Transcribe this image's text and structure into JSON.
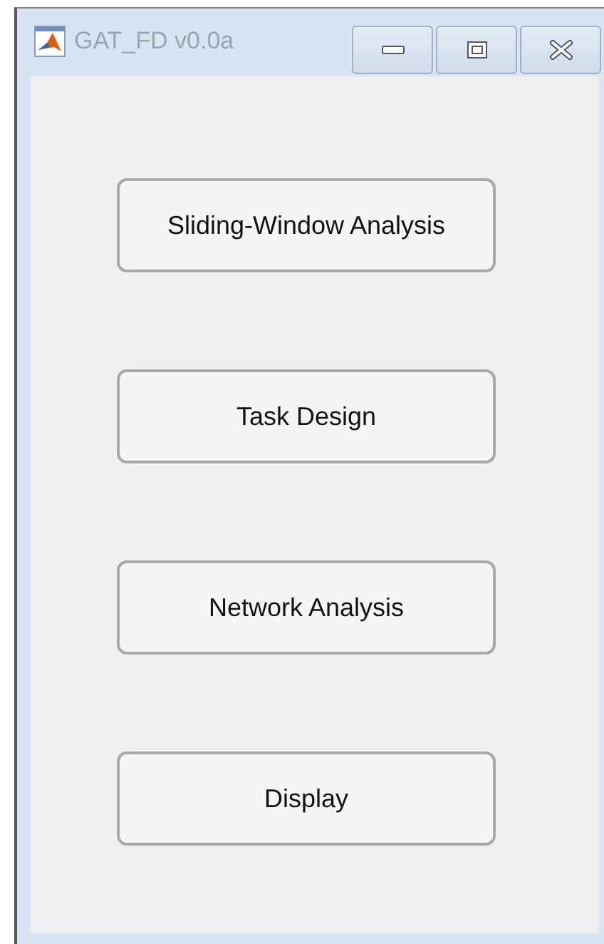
{
  "window": {
    "title": "GAT_FD v0.0a"
  },
  "buttons": [
    {
      "label": "Sliding-Window Analysis"
    },
    {
      "label": "Task Design"
    },
    {
      "label": "Network Analysis"
    },
    {
      "label": "Display"
    }
  ]
}
